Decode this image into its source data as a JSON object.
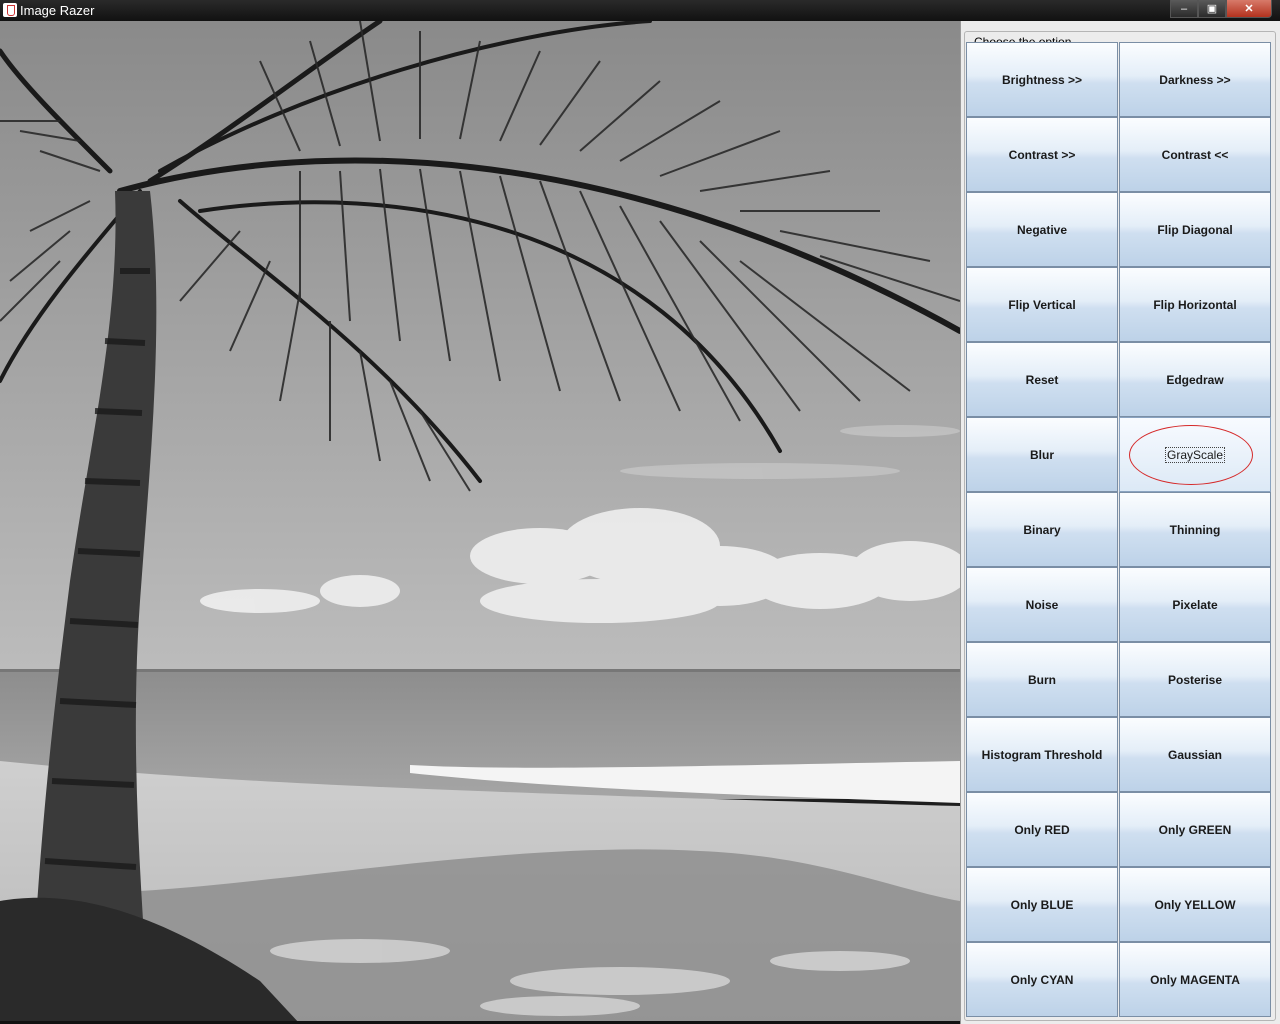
{
  "window": {
    "title": "Image Razer",
    "minimize_glyph": "–",
    "maximize_glyph": "▣",
    "close_glyph": "✕"
  },
  "viewer": {
    "image_description": "grayscale photo of palm tree on beach",
    "icon": "image-canvas"
  },
  "panel": {
    "legend": "Choose the option",
    "buttons": [
      "Brightness >>",
      "Darkness >>",
      "Contrast >>",
      "Contrast <<",
      "Negative",
      "Flip Diagonal",
      "Flip Vertical",
      "Flip Horizontal",
      "Reset",
      "Edgedraw",
      "Blur",
      "GrayScale",
      "Binary",
      "Thinning",
      "Noise",
      "Pixelate",
      "Burn",
      "Posterise",
      "Histogram Threshold",
      "Gaussian",
      "Only RED",
      "Only GREEN",
      "Only BLUE",
      "Only YELLOW",
      "Only CYAN",
      "Only MAGENTA"
    ],
    "focused_button": "GrayScale",
    "annotation_color": "#d52a2a"
  }
}
